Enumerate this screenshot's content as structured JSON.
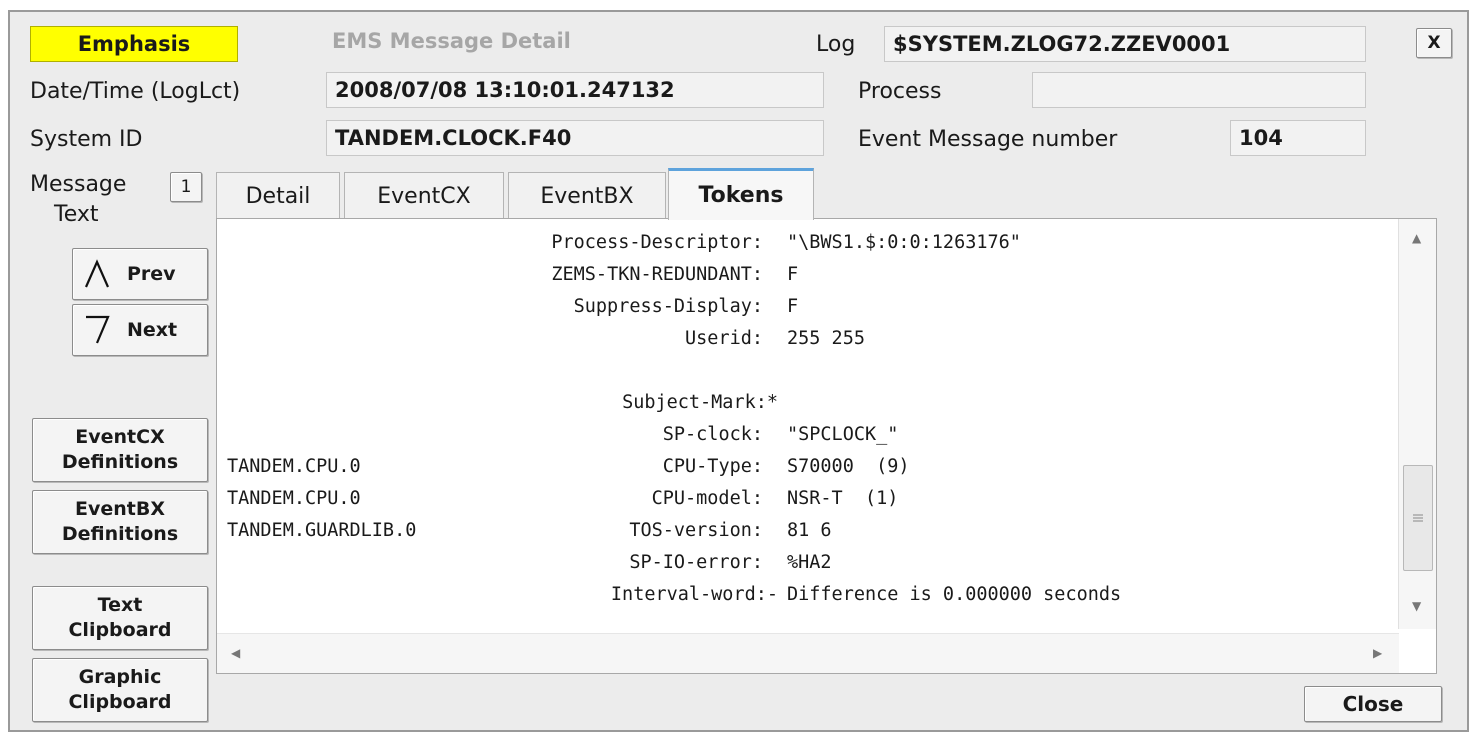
{
  "emphasis_label": "Emphasis",
  "window_title": "EMS Message Detail",
  "log": {
    "label": "Log",
    "value": "$SYSTEM.ZLOG72.ZZEV0001"
  },
  "close_x_label": "X",
  "datetime": {
    "label": "Date/Time (LogLct)",
    "value": "2008/07/08 13:10:01.247132"
  },
  "process": {
    "label": "Process",
    "value": ""
  },
  "system_id": {
    "label": "System ID",
    "value": "TANDEM.CLOCK.F40"
  },
  "event_number": {
    "label": "Event Message number",
    "value": "104"
  },
  "message_text": {
    "label_line1": "Message",
    "label_line2": "Text",
    "count": "1"
  },
  "nav": {
    "prev_label": "Prev",
    "next_label": "Next"
  },
  "side_buttons": {
    "eventcx": [
      "EventCX",
      "Definitions"
    ],
    "eventbx": [
      "EventBX",
      "Definitions"
    ],
    "text_clip": [
      "Text",
      "Clipboard"
    ],
    "graphic_clip": [
      "Graphic",
      "Clipboard"
    ]
  },
  "tabs": [
    {
      "label": "Detail",
      "active": false
    },
    {
      "label": "EventCX",
      "active": false
    },
    {
      "label": "EventBX",
      "active": false
    },
    {
      "label": "Tokens",
      "active": true
    }
  ],
  "tokens": [
    {
      "left": "",
      "name": "Process-Descriptor:",
      "value": "\"\\BWS1.$:0:0:1263176\""
    },
    {
      "left": "",
      "name": "ZEMS-TKN-REDUNDANT:",
      "value": "F"
    },
    {
      "left": "",
      "name": "Suppress-Display:",
      "value": "F"
    },
    {
      "left": "",
      "name": "Userid:",
      "value": "255 255"
    },
    {
      "left": "",
      "name": "",
      "value": ""
    },
    {
      "left": "",
      "name": "Subject-Mark:*",
      "value": ""
    },
    {
      "left": "",
      "name": "SP-clock:",
      "value": "\"SPCLOCK_\""
    },
    {
      "left": "TANDEM.CPU.0",
      "name": "CPU-Type:",
      "value": "S70000  (9)"
    },
    {
      "left": "TANDEM.CPU.0",
      "name": "CPU-model:",
      "value": "NSR-T  (1)"
    },
    {
      "left": "TANDEM.GUARDLIB.0",
      "name": "TOS-version:",
      "value": "81 6"
    },
    {
      "left": "",
      "name": "SP-IO-error:",
      "value": "%HA2"
    },
    {
      "left": "",
      "name": "Interval-word:-",
      "value": "Difference is 0.000000 seconds"
    }
  ],
  "close_label": "Close",
  "colors": {
    "emphasis": "#ffff00",
    "tab_accent": "#5ea3dc",
    "panel": "#ececec"
  },
  "icons": {
    "prev": "triangle-up-icon",
    "next": "triangle-down-icon",
    "scroll_grip": "grip-lines-icon"
  }
}
